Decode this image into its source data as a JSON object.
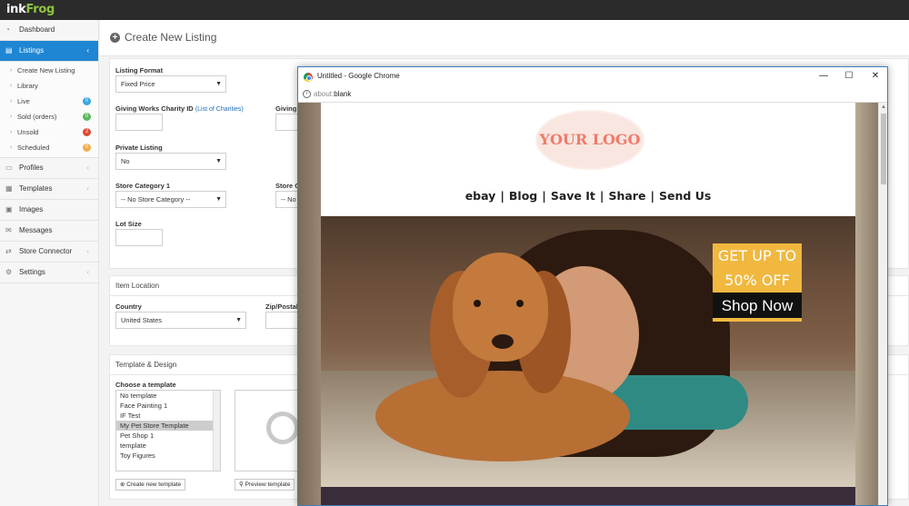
{
  "app": {
    "logo_ink": "ink",
    "logo_frog": "Frog"
  },
  "sidebar": {
    "items": [
      {
        "label": "Dashboard",
        "icon": "dashboard-icon"
      },
      {
        "label": "Listings",
        "icon": "listings-icon",
        "active": true
      },
      {
        "label": "Profiles",
        "icon": "profiles-icon"
      },
      {
        "label": "Templates",
        "icon": "templates-icon"
      },
      {
        "label": "Images",
        "icon": "images-icon"
      },
      {
        "label": "Messages",
        "icon": "messages-icon"
      },
      {
        "label": "Store Connector",
        "icon": "store-connector-icon"
      },
      {
        "label": "Settings",
        "icon": "settings-icon"
      }
    ],
    "sub_items": [
      {
        "label": "Create New Listing"
      },
      {
        "label": "Library"
      },
      {
        "label": "Live",
        "badge": "0",
        "badge_color": "#3aa6df"
      },
      {
        "label": "Sold (orders)",
        "badge": "0",
        "badge_color": "#5cb85c"
      },
      {
        "label": "Unsold",
        "badge": "2",
        "badge_color": "#e0492f"
      },
      {
        "label": "Scheduled",
        "badge": "0",
        "badge_color": "#f0ad4e"
      }
    ]
  },
  "page": {
    "title": "Create New Listing"
  },
  "form": {
    "listing_format_label": "Listing Format",
    "listing_format_value": "Fixed Price",
    "charity_label": "Giving Works Charity ID",
    "charity_link": "(List of Charities)",
    "giving_label_cut": "Giving V",
    "private_label": "Private Listing",
    "private_value": "No",
    "store_cat1_label": "Store Category 1",
    "store_cat1_value": "-- No Store Category --",
    "store_cat2_label_cut": "Store C",
    "store_cat2_value_cut": "-- No",
    "lot_size_label": "Lot Size"
  },
  "location": {
    "section_title": "Item Location",
    "country_label": "Country",
    "country_value": "United States",
    "zip_label": "Zip/Postal"
  },
  "template_design": {
    "section_title": "Template & Design",
    "choose_label": "Choose a template",
    "options": [
      "No template",
      "Face Painting 1",
      "IF Test",
      "My Pet Store Template",
      "Pet Shop 1",
      "template",
      "Toy Figures"
    ],
    "selected_index": 3,
    "create_button": "Create new template",
    "preview_button": "Preview template"
  },
  "popup": {
    "window_title": "Untitled - Google Chrome",
    "url_scheme": "about:",
    "url_rest": "blank",
    "minimize": "—",
    "maximize": "☐",
    "close": "✕",
    "store": {
      "logo_text": "YOUR LOGO",
      "nav": [
        "ebay",
        "Blog",
        "Save It",
        "Share",
        "Send Us"
      ],
      "nav_separator": "|",
      "promo_line1": "GET UP TO",
      "promo_line2": "50% OFF",
      "promo_button": "Shop Now"
    }
  }
}
